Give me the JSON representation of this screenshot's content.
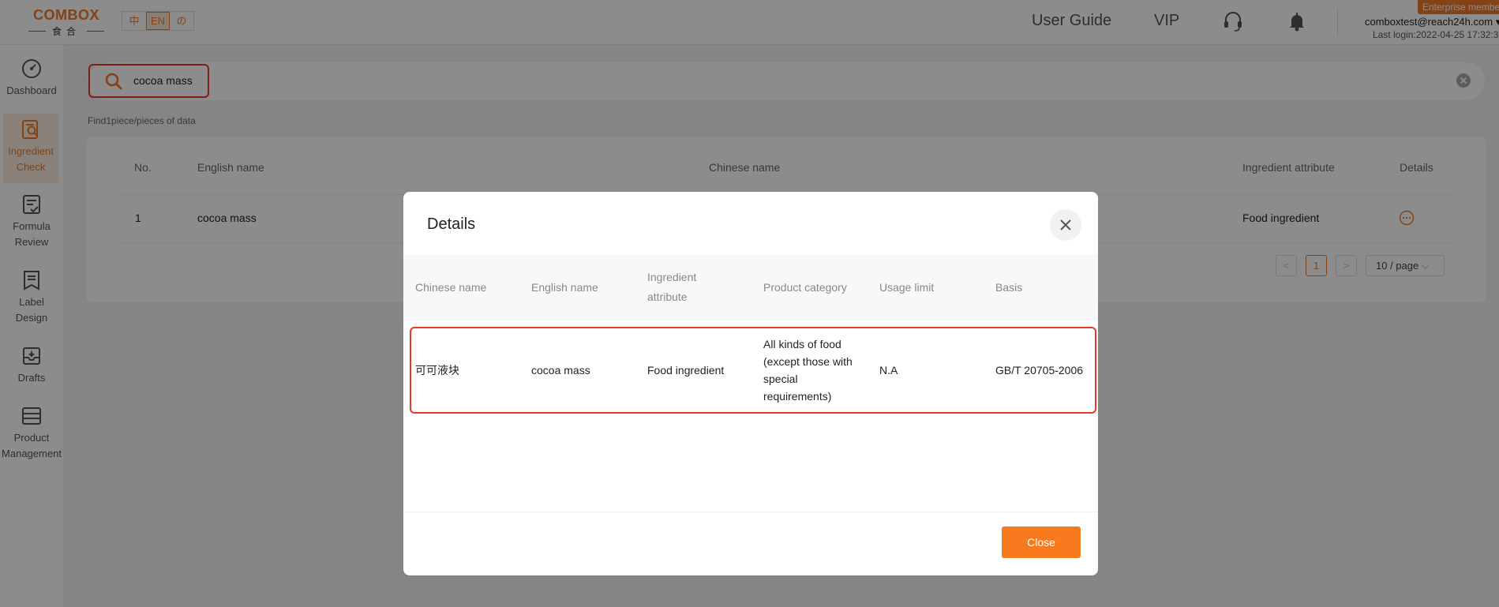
{
  "header": {
    "logo_main": "COMBOX",
    "logo_sub": "食合",
    "languages": [
      "中",
      "EN",
      "の"
    ],
    "active_language": "EN",
    "nav_user_guide": "User Guide",
    "nav_vip": "VIP",
    "user_email": "comboxtest@reach24h.com",
    "last_login": "Last login:2022-04-25 17:32:3",
    "enterprise_badge": "Enterprise membe"
  },
  "sidebar": {
    "items": [
      {
        "label_line1": "Dashboard",
        "label_line2": "",
        "icon": "dashboard-icon"
      },
      {
        "label_line1": "Ingredient",
        "label_line2": "Check",
        "icon": "ingredient-check-icon"
      },
      {
        "label_line1": "Formula",
        "label_line2": "Review",
        "icon": "formula-review-icon"
      },
      {
        "label_line1": "Label",
        "label_line2": "Design",
        "icon": "label-design-icon"
      },
      {
        "label_line1": "Drafts",
        "label_line2": "",
        "icon": "drafts-icon"
      },
      {
        "label_line1": "Product",
        "label_line2": "Management",
        "icon": "product-management-icon"
      }
    ]
  },
  "search": {
    "value": "cocoa mass",
    "result_count": "Find1piece/pieces of data"
  },
  "table": {
    "headers": {
      "no": "No.",
      "english_name": "English name",
      "chinese_name": "Chinese name",
      "ingredient_attribute": "Ingredient attribute",
      "details": "Details"
    },
    "row": {
      "no": "1",
      "english_name": "cocoa mass",
      "ingredient_attribute": "Food ingredient"
    },
    "pagination": {
      "prev": "<",
      "current": "1",
      "next": ">",
      "page_size": "10 / page"
    }
  },
  "modal": {
    "title": "Details",
    "headers": {
      "chinese_name": "Chinese name",
      "english_name": "English name",
      "ingredient_attribute_l1": "Ingredient",
      "ingredient_attribute_l2": "attribute",
      "product_category": "Product category",
      "usage_limit": "Usage limit",
      "basis": "Basis"
    },
    "row": {
      "chinese_name": "可可液块",
      "english_name": "cocoa mass",
      "ingredient_attribute": "Food ingredient",
      "product_category_l1": "All kinds of food",
      "product_category_l2": "(except those with",
      "product_category_l3": "special",
      "product_category_l4": "requirements)",
      "usage_limit": "N.A",
      "basis": "GB/T 20705-2006"
    },
    "close_label": "Close"
  },
  "colors": {
    "brand": "#ee7a2b",
    "close_button": "#f77b1e",
    "highlight": "#e53a2b"
  }
}
